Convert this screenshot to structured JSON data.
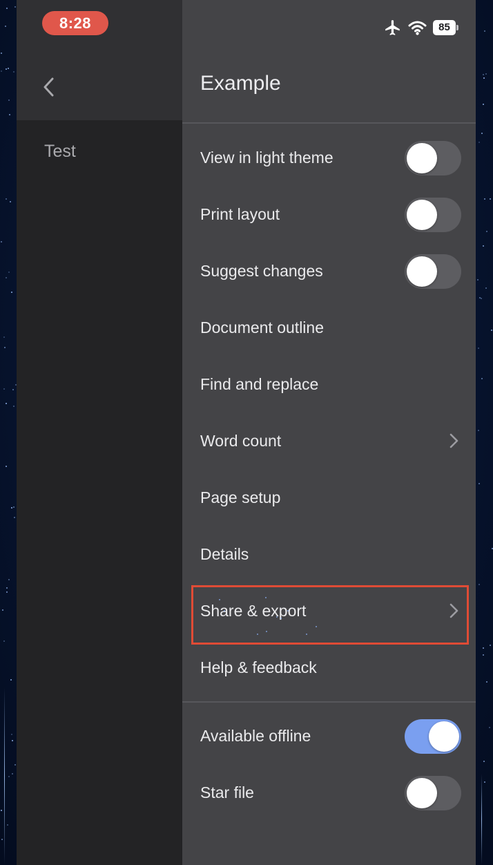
{
  "status_bar": {
    "time": "8:28",
    "battery_level": "85",
    "icons": [
      "airplane-icon",
      "wifi-icon",
      "battery-icon"
    ],
    "time_pill_color": "#e0574b"
  },
  "left_pane": {
    "document_name": "Test",
    "back_icon": "chevron-left-icon"
  },
  "menu": {
    "title": "Example",
    "items": [
      {
        "label": "View in light theme",
        "control": "toggle",
        "on": false
      },
      {
        "label": "Print layout",
        "control": "toggle",
        "on": false
      },
      {
        "label": "Suggest changes",
        "control": "toggle",
        "on": false
      },
      {
        "label": "Document outline",
        "control": "none"
      },
      {
        "label": "Find and replace",
        "control": "none"
      },
      {
        "label": "Word count",
        "control": "chevron"
      },
      {
        "label": "Page setup",
        "control": "none"
      },
      {
        "label": "Details",
        "control": "none"
      },
      {
        "label": "Share & export",
        "control": "chevron",
        "highlighted": true
      },
      {
        "label": "Help & feedback",
        "control": "none"
      },
      {
        "label": "Available offline",
        "control": "toggle",
        "on": true
      },
      {
        "label": "Star file",
        "control": "toggle",
        "on": false
      }
    ]
  },
  "colors": {
    "toggle_on": "#7a9ff0",
    "toggle_off": "#5d5d61",
    "highlight_border": "#e04b35",
    "menu_background": "#444447"
  }
}
